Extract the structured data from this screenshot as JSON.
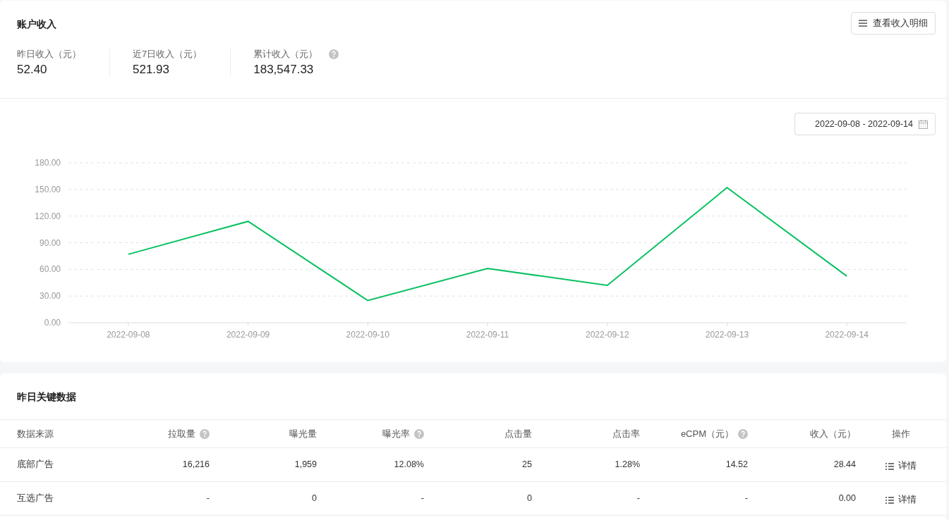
{
  "income": {
    "title": "账户收入",
    "detail_button": "查看收入明细",
    "stats": [
      {
        "label": "昨日收入（元）",
        "value": "52.40",
        "help": false
      },
      {
        "label": "近7日收入（元）",
        "value": "521.93",
        "help": false
      },
      {
        "label": "累计收入（元）",
        "value": "183,547.33",
        "help": true
      }
    ],
    "date_range": "2022-09-08 - 2022-09-14",
    "chart_data": {
      "type": "line",
      "categories": [
        "2022-09-08",
        "2022-09-09",
        "2022-09-10",
        "2022-09-11",
        "2022-09-12",
        "2022-09-13",
        "2022-09-14"
      ],
      "series": [
        {
          "color": "#07c160",
          "values": [
            77,
            114,
            25,
            61,
            42,
            152,
            52.4
          ]
        }
      ],
      "grid": true,
      "ylim": [
        0,
        180
      ],
      "yticks": [
        {
          "value": 0,
          "label": "0.00"
        },
        {
          "value": 30,
          "label": "30.00"
        },
        {
          "value": 60,
          "label": "60.00"
        },
        {
          "value": 90,
          "label": "90.00"
        },
        {
          "value": 120,
          "label": "120.00"
        },
        {
          "value": 150,
          "label": "150.00"
        },
        {
          "value": 180,
          "label": "180.00"
        }
      ]
    }
  },
  "key_data": {
    "title": "昨日关键数据",
    "columns": [
      {
        "label": "数据来源",
        "help": false
      },
      {
        "label": "拉取量",
        "help": true
      },
      {
        "label": "曝光量",
        "help": false
      },
      {
        "label": "曝光率",
        "help": true
      },
      {
        "label": "点击量",
        "help": false
      },
      {
        "label": "点击率",
        "help": false
      },
      {
        "label": "eCPM（元）",
        "help": true
      },
      {
        "label": "收入（元）",
        "help": false
      },
      {
        "label": "操作",
        "help": false
      }
    ],
    "rows": [
      {
        "cells": [
          "底部广告",
          "16,216",
          "1,959",
          "12.08%",
          "25",
          "1.28%",
          "14.52",
          "28.44"
        ],
        "action": "详情"
      },
      {
        "cells": [
          "互选广告",
          "-",
          "0",
          "-",
          "0",
          "-",
          "-",
          "0.00"
        ],
        "action": "详情"
      }
    ]
  }
}
